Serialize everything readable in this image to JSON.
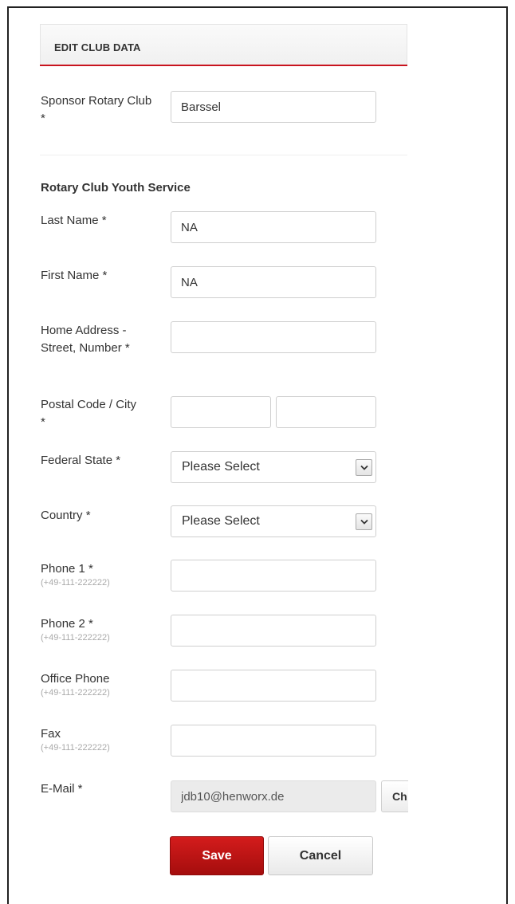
{
  "panel": {
    "title": "EDIT CLUB DATA"
  },
  "sponsor": {
    "label": "Sponsor Rotary Club *",
    "value": "Barssel"
  },
  "section": {
    "title": "Rotary Club Youth Service"
  },
  "fields": {
    "last_name": {
      "label": "Last Name *",
      "value": "NA"
    },
    "first_name": {
      "label": "First Name *",
      "value": "NA"
    },
    "address": {
      "label": "Home Address - Street, Number *",
      "value": ""
    },
    "postal_city": {
      "label": "Postal Code / City *",
      "postal_value": "",
      "city_value": ""
    },
    "federal_state": {
      "label": "Federal State *",
      "selected": "Please Select"
    },
    "country": {
      "label": "Country *",
      "selected": "Please Select"
    },
    "phone1": {
      "label": "Phone 1 *",
      "hint": "(+49-111-222222)",
      "value": ""
    },
    "phone2": {
      "label": "Phone 2 *",
      "hint": "(+49-111-222222)",
      "value": ""
    },
    "office_phone": {
      "label": "Office Phone",
      "hint": "(+49-111-222222)",
      "value": ""
    },
    "fax": {
      "label": "Fax",
      "hint": "(+49-111-222222)",
      "value": ""
    },
    "email": {
      "label": "E-Mail *",
      "value": "jdb10@henworx.de",
      "change_label": "Ch"
    }
  },
  "buttons": {
    "save": "Save",
    "cancel": "Cancel"
  },
  "colors": {
    "accent": "#c8141e",
    "save_button": "#b81414"
  }
}
